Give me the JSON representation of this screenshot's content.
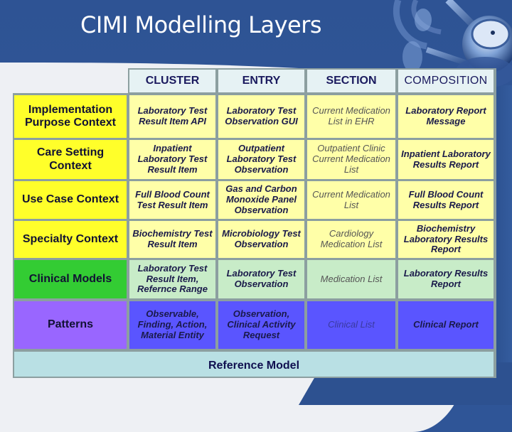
{
  "slide": {
    "title": "CIMI Modelling Layers",
    "decoration": "stethoscope-image"
  },
  "colors": {
    "background_blue": "#2f5597",
    "header_fill": "#e6f2f4",
    "context_label_yellow": "#ffff2a",
    "context_cell_yellow": "#ffffa8",
    "clinical_label_green": "#33cc33",
    "clinical_cell_green": "#c8ecc8",
    "patterns_label_purple": "#9966ff",
    "patterns_cell_blue": "#5a55ff",
    "reference_model_fill": "#b9e0e4"
  },
  "table": {
    "columns": [
      "CLUSTER",
      "ENTRY",
      "SECTION",
      "COMPOSITION"
    ],
    "rows": [
      {
        "label": "Implementation Purpose Context",
        "cells": [
          "Laboratory Test Result Item API",
          "Laboratory Test Observation GUI",
          "Current Medication List in EHR",
          "Laboratory Report Message"
        ]
      },
      {
        "label": "Care Setting Context",
        "cells": [
          "Inpatient Laboratory Test Result Item",
          "Outpatient Laboratory Test Observation",
          "Outpatient Clinic Current Medication List",
          "Inpatient Laboratory Results Report"
        ]
      },
      {
        "label": "Use Case Context",
        "cells": [
          "Full Blood Count Test Result Item",
          "Gas and Carbon Monoxide Panel Observation",
          "Current Medication List",
          "Full Blood Count Results Report"
        ]
      },
      {
        "label": "Specialty Context",
        "cells": [
          "Biochemistry Test Result Item",
          "Microbiology Test Observation",
          "Cardiology Medication List",
          "Biochemistry Laboratory Results Report"
        ]
      },
      {
        "label": "Clinical Models",
        "cells": [
          "Laboratory Test Result Item, Refernce Range",
          "Laboratory Test Observation",
          "Medication List",
          "Laboratory Results Report"
        ]
      },
      {
        "label": "Patterns",
        "cells": [
          "Observable, Finding, Action, Material Entity",
          "Observation, Clinical Activity Request",
          "Clinical List",
          "Clinical Report"
        ]
      }
    ],
    "footer": "Reference Model"
  }
}
